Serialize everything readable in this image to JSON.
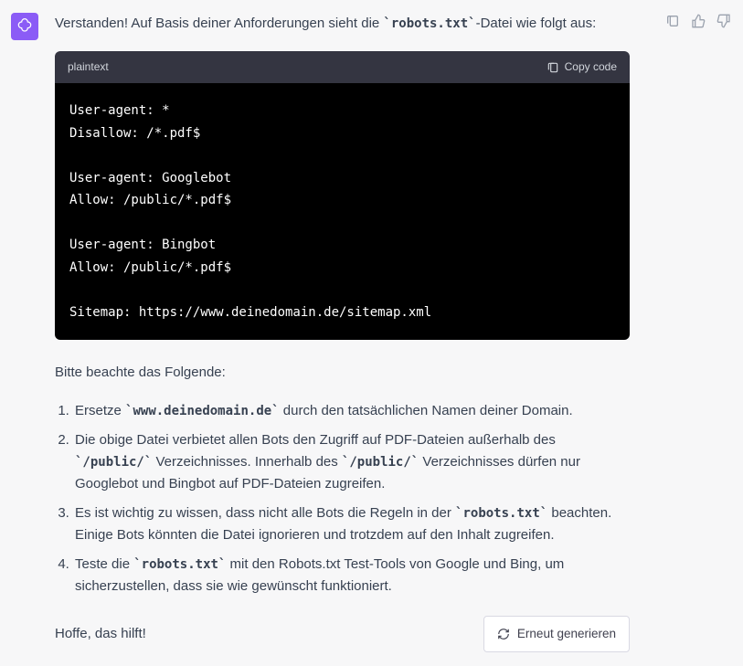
{
  "message": {
    "intro_pre": "Verstanden! Auf Basis deiner Anforderungen sieht die ",
    "intro_code": "`robots.txt`",
    "intro_post": "-Datei wie folgt aus:",
    "followup": "Bitte beachte das Folgende:",
    "closing": "Hoffe, das hilft!"
  },
  "codeblock": {
    "lang": "plaintext",
    "copy_label": "Copy code",
    "content": "User-agent: *\nDisallow: /*.pdf$\n\nUser-agent: Googlebot\nAllow: /public/*.pdf$\n\nUser-agent: Bingbot\nAllow: /public/*.pdf$\n\nSitemap: https://www.deinedomain.de/sitemap.xml"
  },
  "notes": [
    {
      "pre": "Ersetze ",
      "code1": "`www.deinedomain.de`",
      "mid": " durch den tatsächlichen Namen deiner Domain.",
      "code2": "",
      "post": ""
    },
    {
      "pre": "Die obige Datei verbietet allen Bots den Zugriff auf PDF-Dateien außerhalb des ",
      "code1": "`/public/`",
      "mid": " Verzeichnisses. Innerhalb des ",
      "code2": "`/public/`",
      "post": " Verzeichnisses dürfen nur Googlebot und Bingbot auf PDF-Dateien zugreifen."
    },
    {
      "pre": "Es ist wichtig zu wissen, dass nicht alle Bots die Regeln in der ",
      "code1": "`robots.txt`",
      "mid": " beachten. Einige Bots könnten die Datei ignorieren und trotzdem auf den Inhalt zugreifen.",
      "code2": "",
      "post": ""
    },
    {
      "pre": "Teste die ",
      "code1": "`robots.txt`",
      "mid": " mit den Robots.txt Test-Tools von Google und Bing, um sicherzustellen, dass sie wie gewünscht funktioniert.",
      "code2": "",
      "post": ""
    }
  ],
  "regen": {
    "label": "Erneut generieren"
  }
}
